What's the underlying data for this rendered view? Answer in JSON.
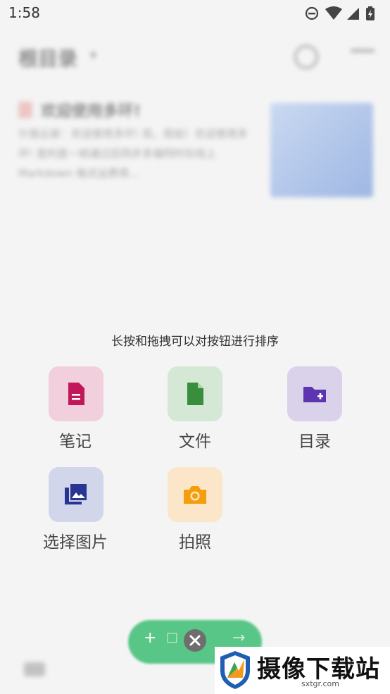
{
  "status": {
    "time": "1:58"
  },
  "header": {
    "title": "根目录",
    "title_dropdown": "▾"
  },
  "note": {
    "title": "欢迎使用多环!",
    "excerpt": "什我云家：欢迎使用多环! 现，简如！欢迎使用多环! 是利是一帧通过后同步多端同时在线上 Markdown 格式运费用..."
  },
  "hint": "长按和拖拽可以对按钮进行排序",
  "actions": [
    {
      "label": "笔记",
      "icon": "note-icon",
      "tile_bg": "#F1CFDD",
      "icon_color": "#C2185B"
    },
    {
      "label": "文件",
      "icon": "file-icon",
      "tile_bg": "#D5E8D6",
      "icon_color": "#388E3C"
    },
    {
      "label": "目录",
      "icon": "new-folder-icon",
      "tile_bg": "#DAD2EA",
      "icon_color": "#5E35B1"
    },
    {
      "label": "选择图片",
      "icon": "image-icon",
      "tile_bg": "#D2D6EA",
      "icon_color": "#283593"
    },
    {
      "label": "拍照",
      "icon": "camera-icon",
      "tile_bg": "#FCE6C9",
      "icon_color": "#F59E0B"
    }
  ],
  "fab": {
    "plus": "+",
    "left_glyph": "□",
    "arrow": "→",
    "accent": "#3DBE73"
  },
  "watermark": {
    "title": "摄像下载站",
    "url": "sxtgr.com"
  }
}
